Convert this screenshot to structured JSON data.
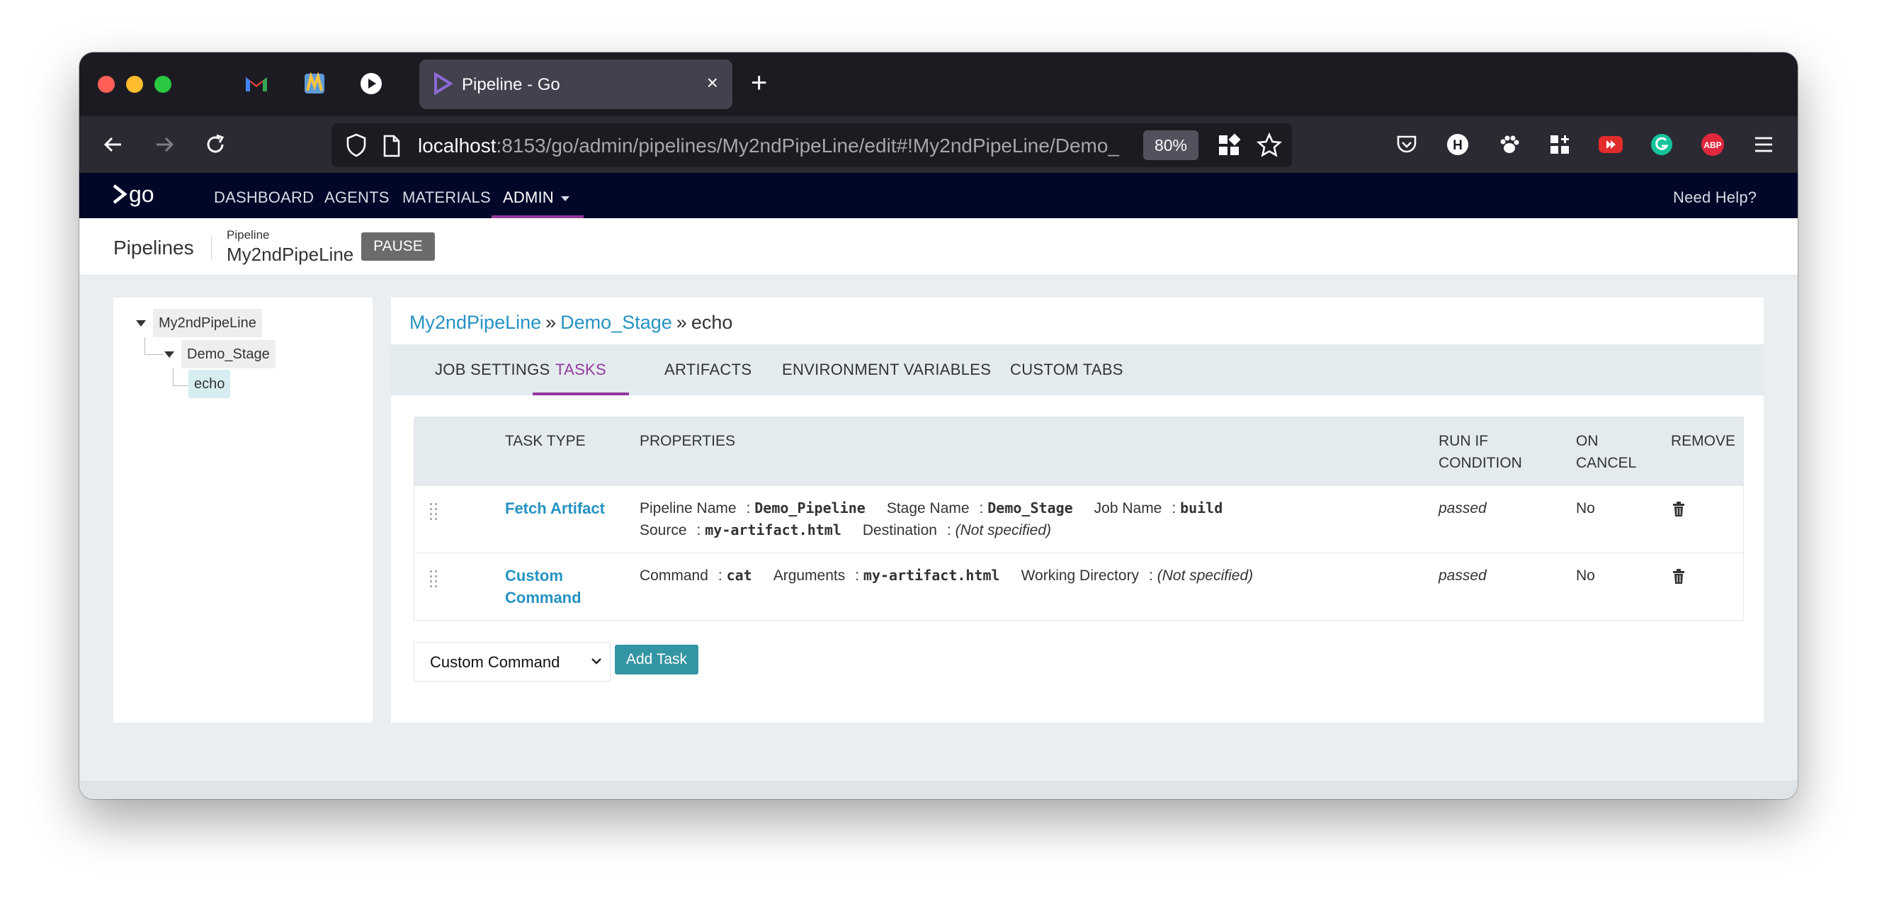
{
  "browser": {
    "tab_title": "Pipeline - Go",
    "tab_close": "×",
    "new_tab": "+",
    "url_host": "localhost",
    "url_rest": ":8153/go/admin/pipelines/My2ndPipeLine/edit#!My2ndPipeLine/Demo_",
    "zoom": "80%",
    "extension_h_label": "H",
    "extension_abp_label": "ABP",
    "colors": {
      "tabbar": "#1c1b22",
      "navbar": "#2b2a33",
      "active_tab": "#42414d"
    }
  },
  "go_header": {
    "logo_text": "go",
    "nav": [
      "DASHBOARD",
      "AGENTS",
      "MATERIALS",
      "ADMIN"
    ],
    "help": "Need Help?",
    "accent": "#943a9e"
  },
  "page_header": {
    "section": "Pipelines",
    "pipeline_label": "Pipeline",
    "pipeline_name": "My2ndPipeLine",
    "pause": "PAUSE"
  },
  "tree": {
    "pipeline": "My2ndPipeLine",
    "stage": "Demo_Stage",
    "job": "echo"
  },
  "breadcrumb": {
    "pipeline": "My2ndPipeLine",
    "separator": "»",
    "stage": "Demo_Stage",
    "job": "echo"
  },
  "job_tabs": [
    "JOB SETTINGS",
    "TASKS",
    "ARTIFACTS",
    "ENVIRONMENT VARIABLES",
    "CUSTOM TABS"
  ],
  "tasks_table": {
    "headers": {
      "task_type": "TASK TYPE",
      "properties": "PROPERTIES",
      "run_if_1": "RUN IF",
      "run_if_2": "CONDITION",
      "on_cancel_1": "ON",
      "on_cancel_2": "CANCEL",
      "remove": "REMOVE"
    },
    "rows": [
      {
        "task_type": "Fetch Artifact",
        "props": {
          "pipeline_name_k": "Pipeline Name",
          "pipeline_name_v": "Demo_Pipeline",
          "stage_name_k": "Stage Name",
          "stage_name_v": "Demo_Stage",
          "job_name_k": "Job Name",
          "job_name_v": "build",
          "source_k": "Source",
          "source_v": "my-artifact.html",
          "destination_k": "Destination",
          "destination_v": "(Not specified)"
        },
        "run_if": "passed",
        "on_cancel": "No"
      },
      {
        "task_type_1": "Custom",
        "task_type_2": "Command",
        "props": {
          "command_k": "Command",
          "command_v": "cat",
          "arguments_k": "Arguments",
          "arguments_v": "my-artifact.html",
          "workdir_k": "Working Directory",
          "workdir_v": "(Not specified)"
        },
        "run_if": "passed",
        "on_cancel": "No"
      }
    ],
    "colon": ":"
  },
  "add_task": {
    "selected": "Custom Command",
    "button": "Add Task"
  }
}
